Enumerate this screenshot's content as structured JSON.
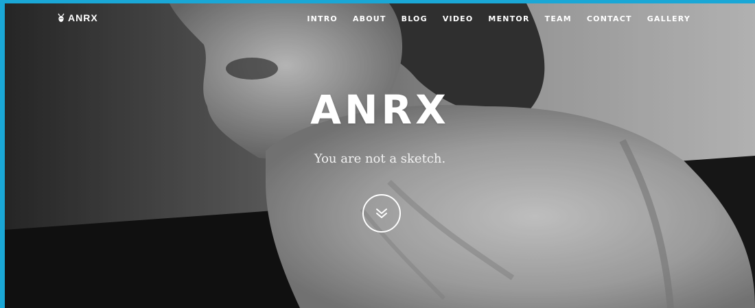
{
  "site": {
    "logo_text": "ANRX",
    "logo_icon": "deer-head-icon"
  },
  "nav": {
    "items": [
      {
        "label": "INTRO"
      },
      {
        "label": "ABOUT"
      },
      {
        "label": "BLOG"
      },
      {
        "label": "VIDEO"
      },
      {
        "label": "MENTOR"
      },
      {
        "label": "TEAM"
      },
      {
        "label": "CONTACT"
      },
      {
        "label": "GALLERY"
      }
    ]
  },
  "hero": {
    "title": "ANRX",
    "subtitle": "You are not a sketch.",
    "scroll_icon": "double-chevron-down-icon"
  },
  "colors": {
    "frame_border": "#1aa7d6",
    "text": "#ffffff"
  }
}
